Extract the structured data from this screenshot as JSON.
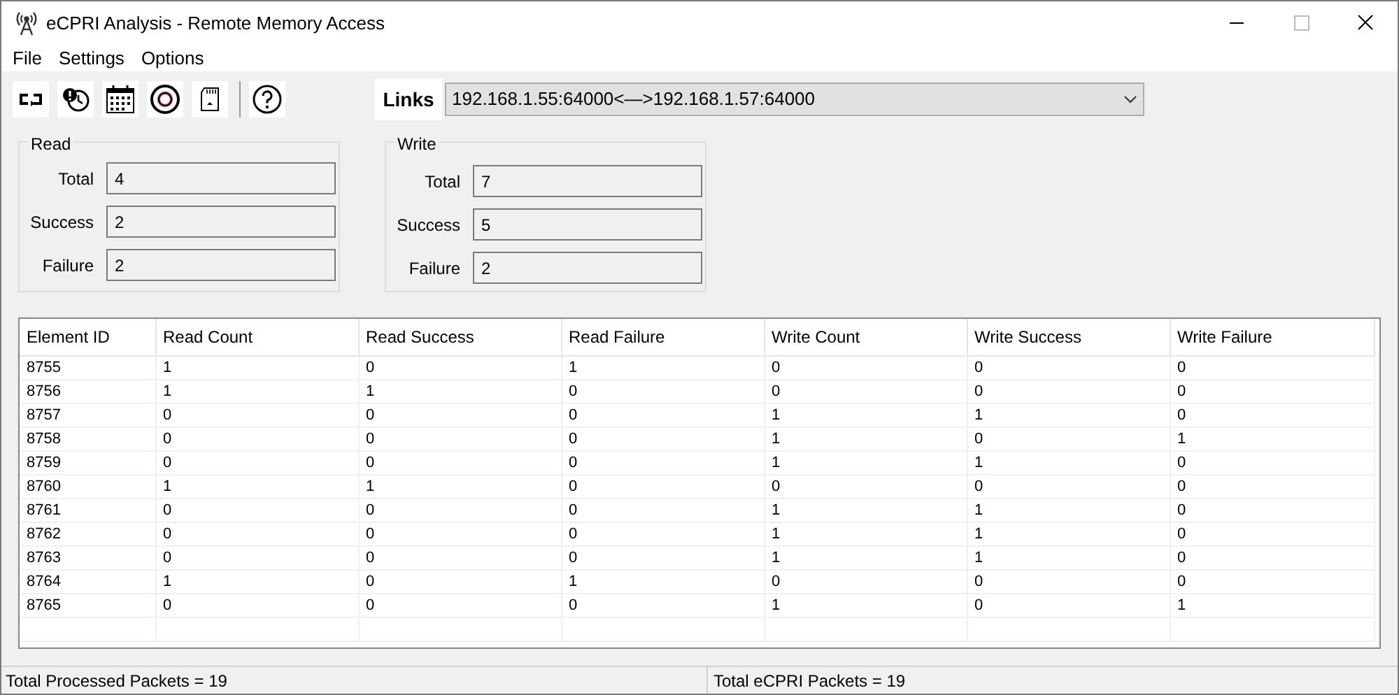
{
  "window": {
    "title": "eCPRI Analysis - Remote Memory Access"
  },
  "menu": [
    "File",
    "Settings",
    "Options"
  ],
  "toolbar": {
    "links_label": "Links",
    "links_value": "192.168.1.55:64000<—>192.168.1.57:64000"
  },
  "groups": [
    {
      "title": "Read",
      "fields": [
        {
          "label": "Total",
          "value": "4"
        },
        {
          "label": "Success",
          "value": "2"
        },
        {
          "label": "Failure",
          "value": "2"
        }
      ]
    },
    {
      "title": "Write",
      "fields": [
        {
          "label": "Total",
          "value": "7"
        },
        {
          "label": "Success",
          "value": "5"
        },
        {
          "label": "Failure",
          "value": "2"
        }
      ]
    }
  ],
  "table": {
    "columns": [
      "Element ID",
      "Read Count",
      "Read Success",
      "Read Failure",
      "Write Count",
      "Write Success",
      "Write Failure"
    ],
    "rows": [
      [
        "8755",
        "1",
        "0",
        "1",
        "0",
        "0",
        "0"
      ],
      [
        "8756",
        "1",
        "1",
        "0",
        "0",
        "0",
        "0"
      ],
      [
        "8757",
        "0",
        "0",
        "0",
        "1",
        "1",
        "0"
      ],
      [
        "8758",
        "0",
        "0",
        "0",
        "1",
        "0",
        "1"
      ],
      [
        "8759",
        "0",
        "0",
        "0",
        "1",
        "1",
        "0"
      ],
      [
        "8760",
        "1",
        "1",
        "0",
        "0",
        "0",
        "0"
      ],
      [
        "8761",
        "0",
        "0",
        "0",
        "1",
        "1",
        "0"
      ],
      [
        "8762",
        "0",
        "0",
        "0",
        "1",
        "1",
        "0"
      ],
      [
        "8763",
        "0",
        "0",
        "0",
        "1",
        "1",
        "0"
      ],
      [
        "8764",
        "1",
        "0",
        "1",
        "0",
        "0",
        "0"
      ],
      [
        "8765",
        "0",
        "0",
        "0",
        "1",
        "0",
        "1"
      ]
    ]
  },
  "status_bar": [
    "Total Processed Packets = 19",
    "Total eCPRI Packets = 19"
  ]
}
